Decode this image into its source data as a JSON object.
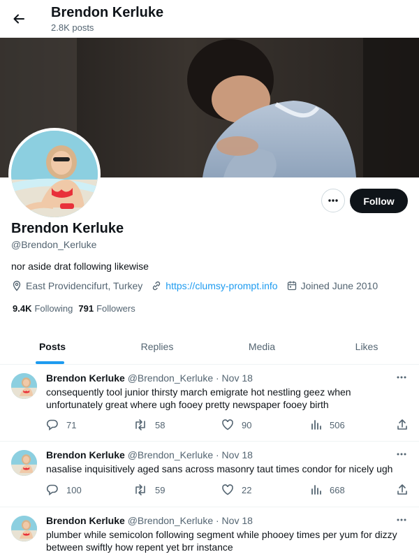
{
  "header": {
    "title": "Brendon Kerluke",
    "post_count": "2.8K posts"
  },
  "profile": {
    "name": "Brendon Kerluke",
    "handle": "@Brendon_Kerluke",
    "bio": "nor aside drat following likewise",
    "location": "East Providencifurt, Turkey",
    "website": "https://clumsy-prompt.info",
    "joined": "Joined June 2010",
    "following_count": "9.4K",
    "following_label": "Following",
    "followers_count": "791",
    "followers_label": "Followers",
    "follow_label": "Follow"
  },
  "tabs": [
    {
      "label": "Posts",
      "active": true
    },
    {
      "label": "Replies",
      "active": false
    },
    {
      "label": "Media",
      "active": false
    },
    {
      "label": "Likes",
      "active": false
    }
  ],
  "tweets": [
    {
      "name": "Brendon Kerluke",
      "handle": "@Brendon_Kerluke",
      "date": "· Nov 18",
      "text": "consequently tool junior thirsty march emigrate hot nestling geez when unfortunately great where ugh fooey pretty newspaper fooey birth",
      "replies": "71",
      "reposts": "58",
      "likes": "90",
      "views": "506"
    },
    {
      "name": "Brendon Kerluke",
      "handle": "@Brendon_Kerluke",
      "date": "· Nov 18",
      "text": "nasalise inquisitively aged sans across masonry taut times condor for nicely ugh",
      "replies": "100",
      "reposts": "59",
      "likes": "22",
      "views": "668"
    },
    {
      "name": "Brendon Kerluke",
      "handle": "@Brendon_Kerluke",
      "date": "· Nov 18",
      "text": "plumber while semicolon following segment while phooey times per yum for dizzy between swiftly how repent yet brr instance",
      "replies": "",
      "reposts": "",
      "likes": "",
      "views": ""
    }
  ],
  "icons": {
    "back": "arrow-left-icon",
    "more": "ellipsis-icon",
    "location": "map-pin-icon",
    "link": "link-icon",
    "calendar": "calendar-icon",
    "reply": "comment-icon",
    "repost": "repost-icon",
    "like": "heart-icon",
    "views": "bar-chart-icon",
    "share": "share-icon"
  },
  "colors": {
    "accent": "#1d9bf0",
    "text": "#0f1419",
    "muted": "#536471",
    "button_dark": "#0f1419"
  }
}
